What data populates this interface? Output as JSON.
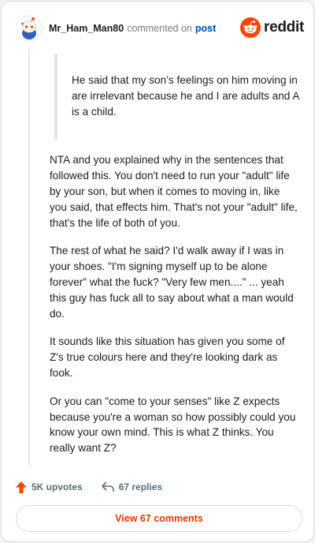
{
  "header": {
    "username": "Mr_Ham_Man80",
    "commented_on": "commented on",
    "post_link": "post",
    "brand": "reddit"
  },
  "comment": {
    "quote": "He said that my son’s feelings on him moving in are irrelevant because he and I are adults and A is a child.",
    "paragraphs": [
      "NTA and you explained why in the sentences that followed this. You don't need to run your \"adult\" life by your son, but when it comes to moving in, like you said, that effects him. That's not your \"adult\" life, that's the life of both of you.",
      "The rest of what he said? I'd walk away if I was in your shoes. \"I'm signing myself up to be alone forever\" what the fuck? \"Very few men....\" ... yeah this guy has fuck all to say about what a man would do.",
      "It sounds like this situation has given you some of Z's true colours here and they're looking dark as fook.",
      "Or you can \"come to your senses\" like Z expects because you're a woman so how possibly could you know your own mind. This is what Z thinks. You really want Z?"
    ]
  },
  "footer": {
    "upvotes": "5K upvotes",
    "replies": "67 replies",
    "view_comments": "View 67 comments"
  },
  "colors": {
    "brand_orange": "#ff4500",
    "link_blue": "#0045ac",
    "button_text": "#d93a00"
  },
  "icons": {
    "avatar": "snoo-avatar",
    "brand": "reddit-logo",
    "upvote": "upvote-arrow-icon",
    "reply": "reply-arrow-icon"
  }
}
